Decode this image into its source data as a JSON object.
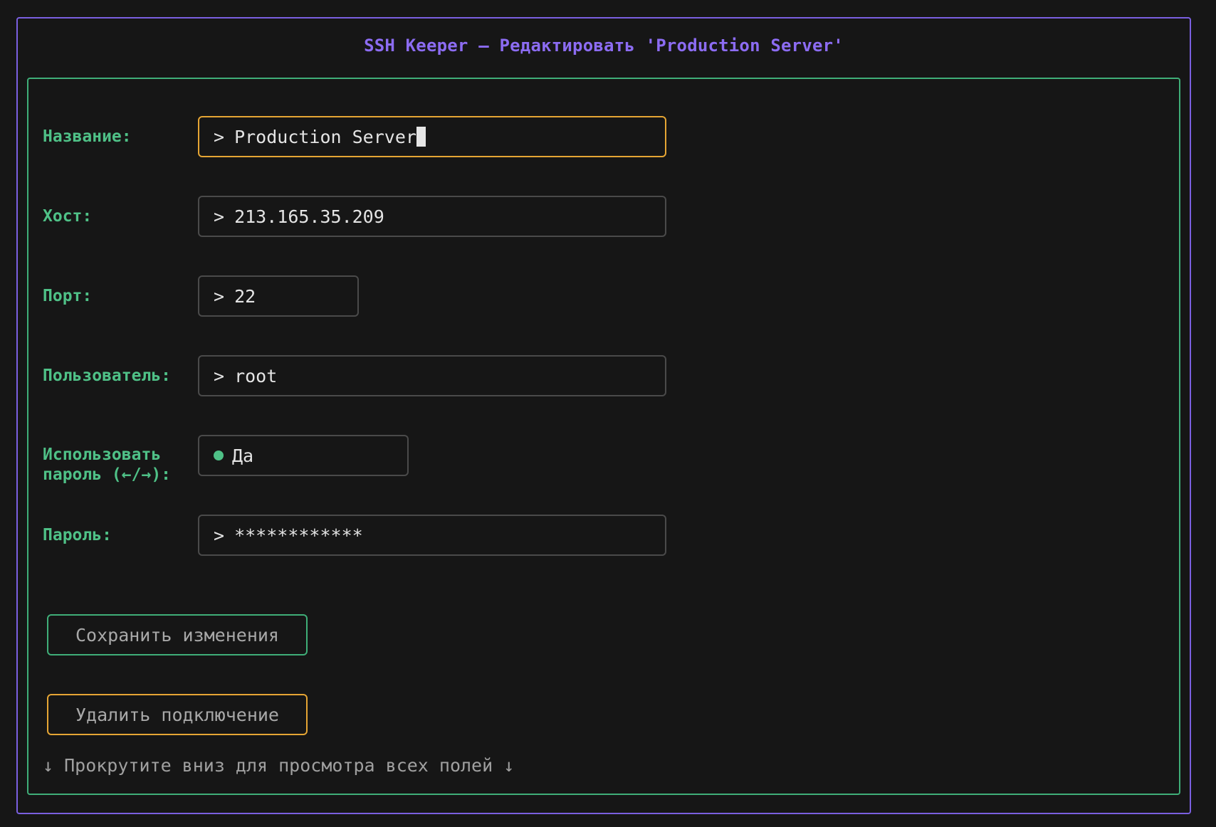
{
  "app": {
    "title": "SSH Keeper – Редактировать 'Production Server'",
    "accent_color": "#7a5fe0",
    "form_border_color": "#3fae78",
    "focus_color": "#e5a534"
  },
  "form": {
    "prompt_symbol": ">",
    "fields": {
      "name": {
        "label": "Название:",
        "value": "Production Server",
        "focused": true
      },
      "host": {
        "label": "Хост:",
        "value": "213.165.35.209"
      },
      "port": {
        "label": "Порт:",
        "value": "22"
      },
      "user": {
        "label": "Пользователь:",
        "value": "root"
      },
      "use_password": {
        "label_line1": "Использовать",
        "label_line2": "пароль (←/→):",
        "value": "Да",
        "indicator_color": "#4fc187"
      },
      "password": {
        "label": "Пароль:",
        "value": "************"
      }
    },
    "buttons": {
      "save_label": "Сохранить изменения",
      "delete_label": "Удалить подключение"
    },
    "scroll_hint": "↓ Прокрутите вниз для просмотра всех полей ↓"
  }
}
